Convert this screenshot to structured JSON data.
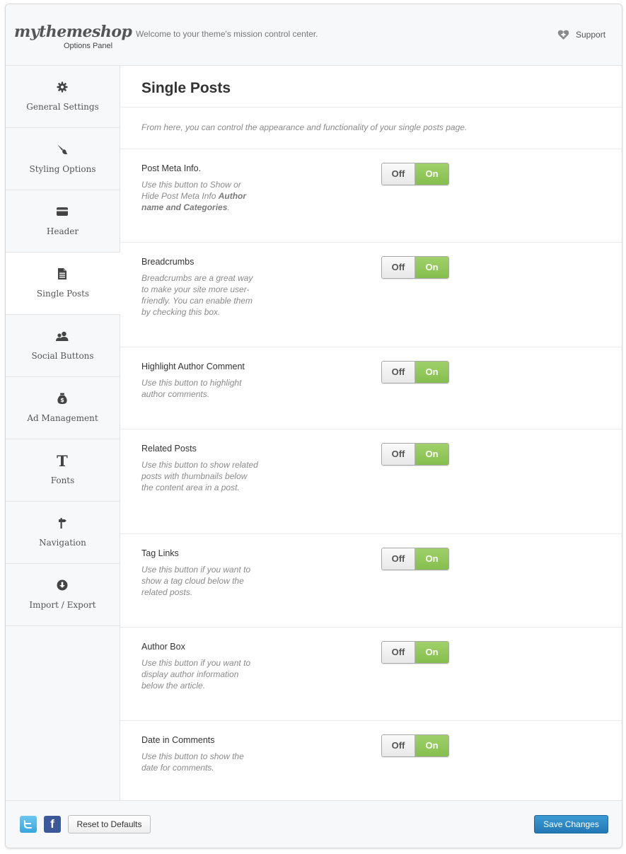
{
  "header": {
    "logo": "mythemeshop",
    "logo_sub": "Options Panel",
    "welcome": "Welcome to your theme's mission control center.",
    "support_label": "Support",
    "support_icon": "heart-plus-icon"
  },
  "sidebar": {
    "items": [
      {
        "label": "General Settings",
        "icon": "gear-icon",
        "active": false
      },
      {
        "label": "Styling Options",
        "icon": "brush-icon",
        "active": false
      },
      {
        "label": "Header",
        "icon": "card-icon",
        "active": false
      },
      {
        "label": "Single Posts",
        "icon": "document-icon",
        "active": true
      },
      {
        "label": "Social Buttons",
        "icon": "users-icon",
        "active": false
      },
      {
        "label": "Ad Management",
        "icon": "money-bag-icon",
        "active": false
      },
      {
        "label": "Fonts",
        "icon": "type-icon",
        "active": false
      },
      {
        "label": "Navigation",
        "icon": "signpost-icon",
        "active": false
      },
      {
        "label": "Import / Export",
        "icon": "download-circle-icon",
        "active": false
      }
    ]
  },
  "main": {
    "title": "Single Posts",
    "intro": "From here, you can control the appearance and functionality of your single posts page.",
    "options": [
      {
        "title": "Post Meta Info.",
        "desc": "Use this button to Show or Hide Post Meta Info",
        "desc_bold": "Author name and Categories",
        "desc_tail": ".",
        "off": "Off",
        "on": "On"
      },
      {
        "title": "Breadcrumbs",
        "desc": "Breadcrumbs are a great way to make your site more user-friendly. You can enable them by checking this box.",
        "off": "Off",
        "on": "On"
      },
      {
        "title": "Highlight Author Comment",
        "desc": "Use this button to highlight author comments.",
        "off": "Off",
        "on": "On"
      },
      {
        "title": "Related Posts",
        "desc": "Use this button to show related posts with thumbnails below the content area in a post.",
        "off": "Off",
        "on": "On"
      },
      {
        "title": "Tag Links",
        "desc": "Use this button if you want to show a tag cloud below the related posts.",
        "off": "Off",
        "on": "On"
      },
      {
        "title": "Author Box",
        "desc": "Use this button if you want to display author information below the article.",
        "off": "Off",
        "on": "On"
      },
      {
        "title": "Date in Comments",
        "desc": "Use this button to show the date for comments.",
        "off": "Off",
        "on": "On"
      }
    ]
  },
  "footer": {
    "twitter_icon": "twitter-icon",
    "facebook_icon": "facebook-icon",
    "facebook_glyph": "f",
    "reset_label": "Reset to Defaults",
    "save_label": "Save Changes"
  },
  "colors": {
    "toggle_on": "#8cc558",
    "save_button": "#2a84c2"
  }
}
